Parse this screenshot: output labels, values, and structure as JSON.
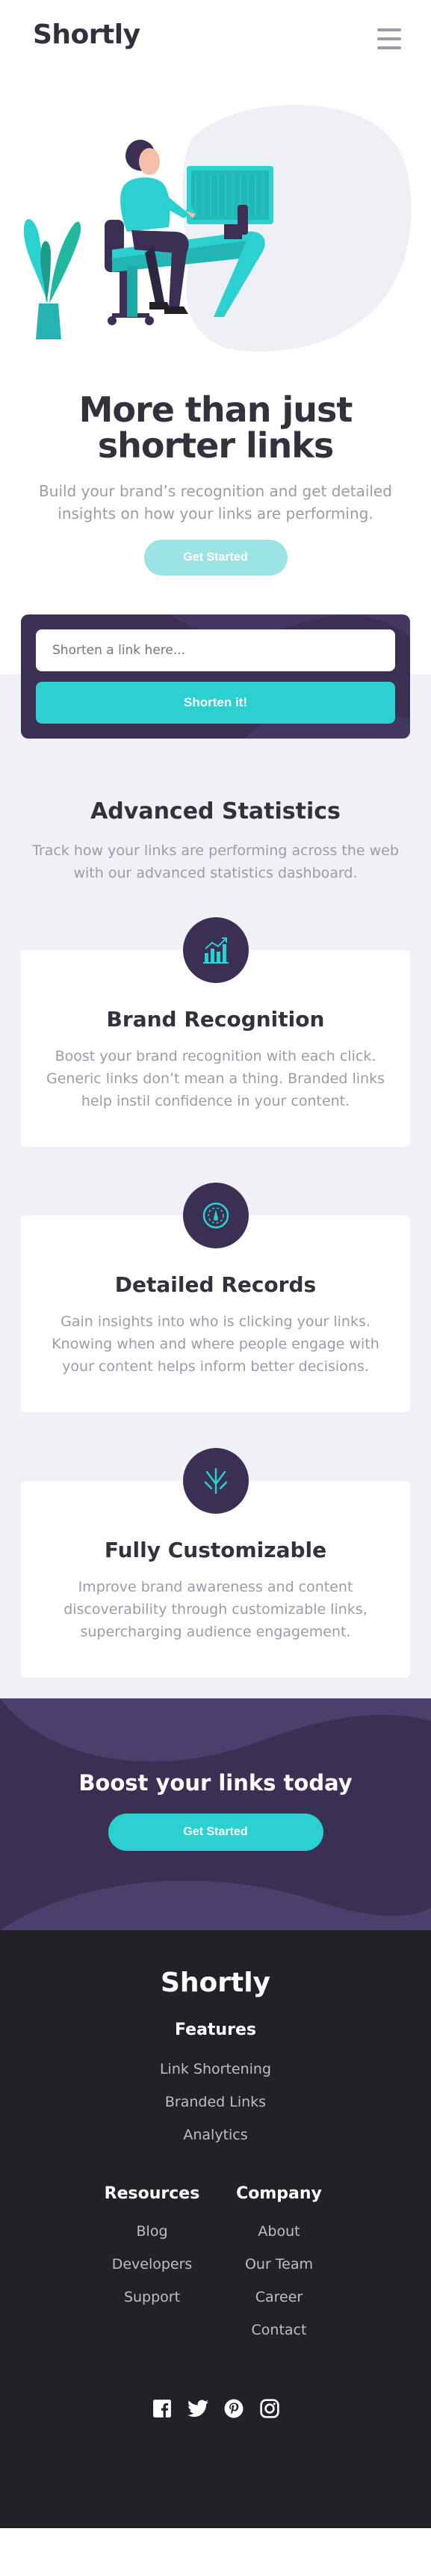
{
  "header": {
    "logo": "Shortly",
    "menu_icon": "hamburger-menu-icon"
  },
  "hero": {
    "illustration": "person-working-at-desk-illustration",
    "title": "More than just shorter links",
    "subtitle": "Build your brand’s recognition and get detailed insights on how your links are performing.",
    "cta_label": "Get Started"
  },
  "shorten": {
    "placeholder": "Shorten a link here...",
    "button_label": "Shorten it!"
  },
  "statistics": {
    "title": "Advanced Statistics",
    "subtitle": "Track how your links are performing across the web with our advanced statistics dashboard.",
    "features": [
      {
        "icon": "brand-recognition-chart-icon",
        "title": "Brand Recognition",
        "body": "Boost your brand recognition with each click. Generic links don’t mean a thing. Branded links help instil confidence in your content."
      },
      {
        "icon": "detailed-records-gauge-icon",
        "title": "Detailed Records",
        "body": "Gain insights into who is clicking your links. Knowing when and where people engage with your content helps inform better decisions."
      },
      {
        "icon": "fully-customizable-brush-icon",
        "title": "Fully Customizable",
        "body": "Improve brand awareness and content discoverability through customizable links, supercharging audience engagement."
      }
    ]
  },
  "boost": {
    "title": "Boost your links today",
    "cta_label": "Get Started"
  },
  "footer": {
    "logo": "Shortly",
    "features": {
      "heading": "Features",
      "links": [
        "Link Shortening",
        "Branded Links",
        "Analytics"
      ]
    },
    "resources": {
      "heading": "Resources",
      "links": [
        "Blog",
        "Developers",
        "Support"
      ]
    },
    "company": {
      "heading": "Company",
      "links": [
        "About",
        "Our Team",
        "Career",
        "Contact"
      ]
    },
    "socials": [
      "facebook-icon",
      "twitter-icon",
      "pinterest-icon",
      "instagram-icon"
    ]
  },
  "colors": {
    "brand_cyan": "#2bd0d0",
    "cta_disabled_cyan": "#9ce3e4",
    "dark_violet": "#3b3054",
    "very_dark_violet": "#232127",
    "gray_text": "#9e9aa7",
    "light_gray_bg": "#eff1f7"
  }
}
